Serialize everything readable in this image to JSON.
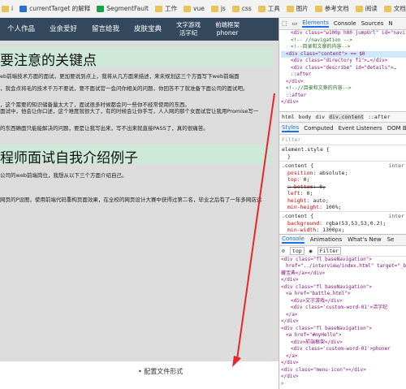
{
  "bookmarks": [
    {
      "icon": "folder-icon",
      "label": "i"
    },
    {
      "icon": "site-icon",
      "label": "currentTarget 的解释"
    },
    {
      "icon": "sf-icon",
      "label": "SegmentFault"
    },
    {
      "icon": "folder-icon",
      "label": "工作"
    },
    {
      "icon": "folder-icon",
      "label": "vue"
    },
    {
      "icon": "folder-icon",
      "label": "js"
    },
    {
      "icon": "folder-icon",
      "label": "css"
    },
    {
      "icon": "folder-icon",
      "label": "工具"
    },
    {
      "icon": "folder-icon",
      "label": "图片"
    },
    {
      "icon": "folder-icon",
      "label": "参考文档"
    },
    {
      "icon": "folder-icon",
      "label": "阅读"
    },
    {
      "icon": "folder-icon",
      "label": "文档"
    }
  ],
  "nav": [
    "个人作品",
    "业余爱好",
    "留言给我",
    "皮肤宝典",
    "文字游戏 活字纪",
    "前端框架 phoner"
  ],
  "article": {
    "heading1": "要注意的关键点",
    "paras1": [
      "eb前端技术方面的面试，更加要说到点上，我将从几方面来描述，来未规划这三个方面写下web前端面",
      "，就会点将毛的技术千万不要说，要不面试官一会问你相关的问题，你回答不了就准备下面公司的面试吧。",
      "，这个需要的知识储备量太大了，面试很多时候都会问一些你不经常使用的东西。",
      "面试中，他会让你口述，这个难度就很大了，有的时候会让你手写，人人网的那个女面试官让我用Promise写一",
      "的东西确面只能能解决的问题，要是让我写出来，写不出来就直接PASS了，真的很痛苦。"
    ],
    "heading2": "程师面试自我介绍例子",
    "paras2": [
      "公司的web前端岗位，我想从以下三个方面介绍自己。",
      "网页的P设图，使用前端代码重构页面效果，在全校的网页设计大赛中获得过第二名，毕业之后有了一年多网店运"
    ],
    "footer_line": "• 配置文件形式"
  },
  "devtools": {
    "tabs": [
      "Elements",
      "Console",
      "Sources",
      "N"
    ],
    "dom_lines": [
      "<div class=\"w100p h80 jumpUrl\" id=\"navi",
      "<!-- //navigation -->",
      "<!--目录和文章的内容-->",
      "<div class=\"content\"> == $0",
      "<div class=\"directory f1\">…</div>",
      "<div class=\"describe\" id=\"details\">…",
      "::after",
      "</div>",
      "<!--//目录和文章的内容-->",
      "::after",
      "</div>"
    ],
    "breadcrumbs": [
      "html",
      "body",
      "div",
      "div.content",
      "::after"
    ],
    "style_tabs": [
      "Styles",
      "Computed",
      "Event Listeners",
      "DOM Breakp"
    ],
    "filter_placeholder": "Filter",
    "element_style": "element.style {",
    "rules": [
      {
        "selector": ".content {",
        "link": "inter",
        "props": [
          {
            "name": "position",
            "value": "absolute;"
          },
          {
            "name": "top",
            "value": "0;"
          },
          {
            "name": "bottom",
            "value": "0;",
            "strike": true
          },
          {
            "name": "left",
            "value": "0;"
          },
          {
            "name": "height",
            "value": "auto;"
          },
          {
            "name": "min-height",
            "value": "100%;"
          }
        ]
      },
      {
        "selector": ".content {",
        "link": "inter",
        "props": [
          {
            "name": "background",
            "value": "rgba(53,53,53,0.2);"
          },
          {
            "name": "min-width",
            "value": "1300px;"
          }
        ]
      }
    ],
    "drawer_tabs": [
      "Console",
      "Animations",
      "What's New",
      "Se"
    ],
    "console_context": "top",
    "console_filter": "Filter",
    "console_lines": [
      "<div class=\"fl baseNavigation\">",
      "href=\"../interview/index.html\" target=\"_bl",
      "藏宝典</a></div>",
      "</div>",
      "<div class=\"fl baseNavigation\">",
      "<a href=\"battle.html\">",
      "<div>文字游戏</div>",
      "<div class='custom-word-01'>活字纪",
      "</a>",
      "</div>",
      "<div class=\"fl baseNavigation\">",
      "<a href=\"#myHello\">",
      "<div>前端框架</div>",
      "<div class='custom-word-01'>phoner",
      "</a>",
      "</div>",
      "<div class=\"menu-icon\"></div>",
      "</div>"
    ],
    "prompt": ">"
  },
  "colors": {
    "nav": "#34495e",
    "band": "#cde8d8",
    "arrow": "#e8262a",
    "overlay": "#dcdcdc"
  }
}
